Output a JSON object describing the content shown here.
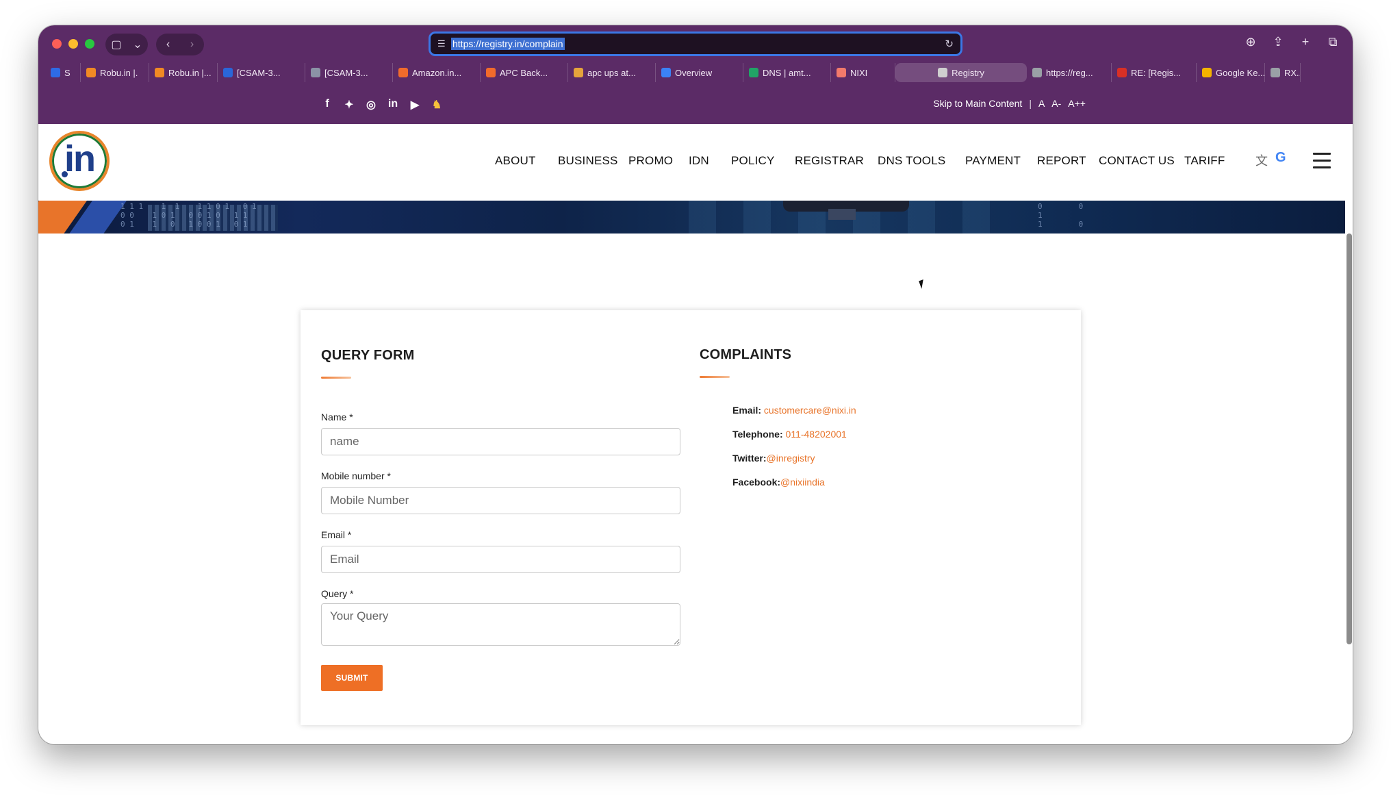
{
  "browser": {
    "url": "https://registry.in/complain",
    "tabs": [
      {
        "label": "S",
        "color": "#2e6be6"
      },
      {
        "label": "Robu.in |.",
        "color": "#f08a24"
      },
      {
        "label": "Robu.in |...",
        "color": "#f08a24"
      },
      {
        "label": "[CSAM-3...",
        "color": "#2a66d9"
      },
      {
        "label": "[CSAM-3...",
        "color": "#8b93a6"
      },
      {
        "label": "Amazon.in...",
        "color": "#f16b2b"
      },
      {
        "label": "APC Back...",
        "color": "#f16b2b"
      },
      {
        "label": "apc ups at...",
        "color": "#e5a43c"
      },
      {
        "label": "Overview",
        "color": "#3b82f6"
      },
      {
        "label": "DNS | amt...",
        "color": "#21a366"
      },
      {
        "label": "NIXI",
        "color": "#f27a6b"
      },
      {
        "label": "Registry",
        "color": "#cfcfcf"
      },
      {
        "label": "https://reg...",
        "color": "#9aa0a6"
      },
      {
        "label": "RE: [Regis...",
        "color": "#d93025"
      },
      {
        "label": "Google Ke...",
        "color": "#f4b400"
      },
      {
        "label": "RX...",
        "color": "#9aa0a6"
      }
    ]
  },
  "topbar": {
    "skip": "Skip to Main Content",
    "sep": "|",
    "font_small": "A",
    "font_minus": "A-",
    "font_plus": "A++"
  },
  "nav": {
    "items": [
      "ABOUT",
      "BUSINESS",
      "PROMO",
      "IDN",
      "POLICY",
      "REGISTRAR",
      "DNS TOOLS",
      "PAYMENT",
      "REPORT",
      "CONTACT US",
      "TARIFF"
    ],
    "google_letter": "G"
  },
  "logo": {
    "text": "in"
  },
  "form": {
    "title": "QUERY FORM",
    "name_label": "Name *",
    "name_placeholder": "name",
    "mobile_label": "Mobile number *",
    "mobile_placeholder": "Mobile Number",
    "email_label": "Email *",
    "email_placeholder": "Email",
    "query_label": "Query *",
    "query_placeholder": "Your Query",
    "submit_label": "SUBMIT"
  },
  "complaints": {
    "title": "COMPLAINTS",
    "email_key": "Email:",
    "email_val": "customercare@nixi.in",
    "phone_key": "Telephone:",
    "phone_val": "011-48202001",
    "twitter_key": "Twitter:",
    "twitter_val": "@inregistry",
    "facebook_key": "Facebook:",
    "facebook_val": "@nixiindia"
  },
  "colors": {
    "brand_purple": "#5b2b66",
    "accent_orange": "#ee6f25",
    "focus_blue": "#3b77e6"
  }
}
